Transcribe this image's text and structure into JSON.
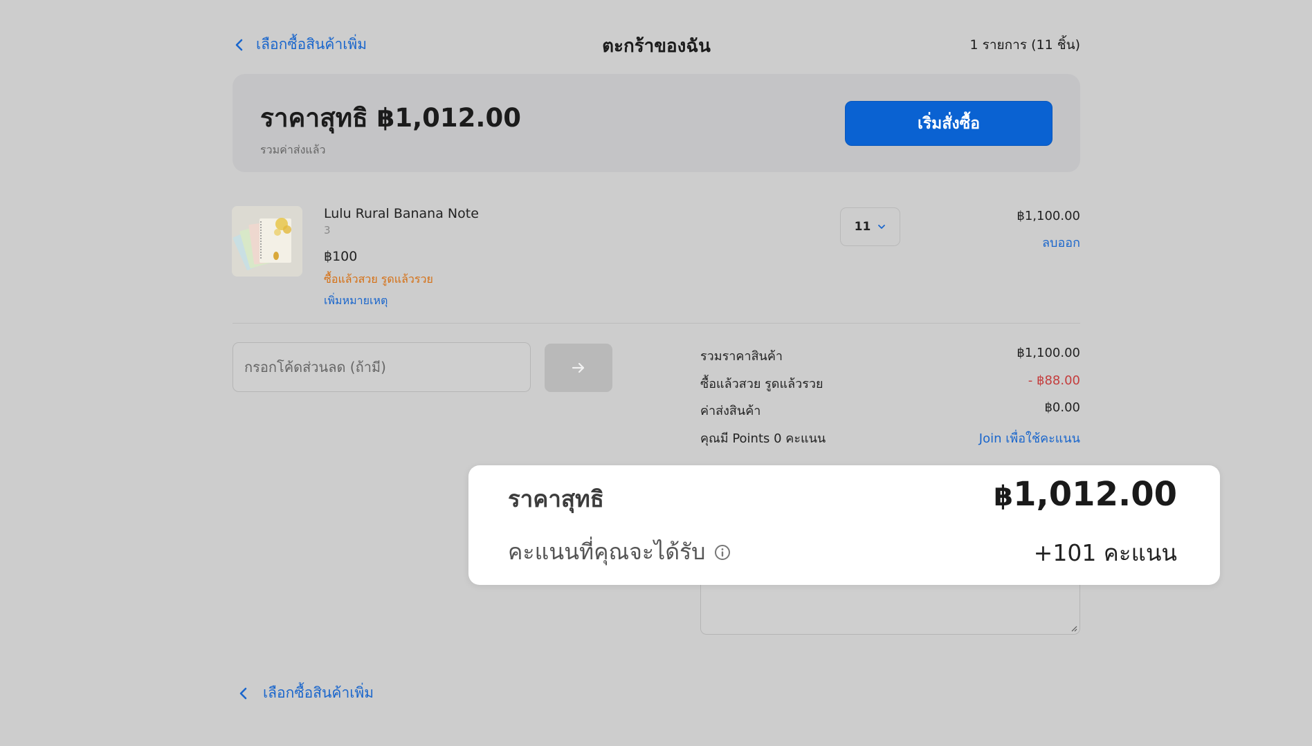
{
  "header": {
    "back_label": "เลือกซื้อสินค้าเพิ่ม",
    "title": "ตะกร้าของฉัน",
    "item_count": "1 รายการ (11 ชิ้น)"
  },
  "summary": {
    "net_price": "ราคาสุทธิ ฿1,012.00",
    "shipping_note": "รวมค่าส่งแล้ว",
    "checkout_label": "เริ่มสั่งซื้อ"
  },
  "product": {
    "name": "Lulu Rural Banana Note",
    "variant": "3",
    "unit_price": "฿100",
    "promo": "ซื้อแล้วสวย รูดแล้วรวย",
    "add_note": "เพิ่มหมายเหตุ",
    "quantity": "11",
    "line_total": "฿1,100.00",
    "remove_label": "ลบออก"
  },
  "coupon": {
    "placeholder": "กรอกโค้ดส่วนลด (ถ้ามี)"
  },
  "breakdown": {
    "subtotal_label": "รวมราคาสินค้า",
    "subtotal_value": "฿1,100.00",
    "discount_label": "ซื้อแล้วสวย รูดแล้วรวย",
    "discount_value": "- ฿88.00",
    "shipping_label": "ค่าส่งสินค้า",
    "shipping_value": "฿0.00",
    "points_label": "คุณมี Points 0 คะแนน",
    "points_link": "Join เพื่อใช้คะแนน"
  },
  "highlight": {
    "net_label": "ราคาสุทธิ",
    "currency": "฿",
    "net_amount": "1,012.00",
    "points_label": "คะแนนที่คุณจะได้รับ",
    "points_value": "+101 คะแนน"
  },
  "footer": {
    "back_label": "เลือกซื้อสินค้าเพิ่ม"
  },
  "colors": {
    "accent": "#0a62d2",
    "link": "#1a66cc",
    "promo": "#d56f13",
    "discount": "#c43c3c",
    "background": "#cdcdcd"
  },
  "icons": {
    "back": "chevron-left-icon",
    "qty_dropdown": "chevron-down-icon",
    "apply": "arrow-right-icon",
    "info": "info-icon"
  }
}
